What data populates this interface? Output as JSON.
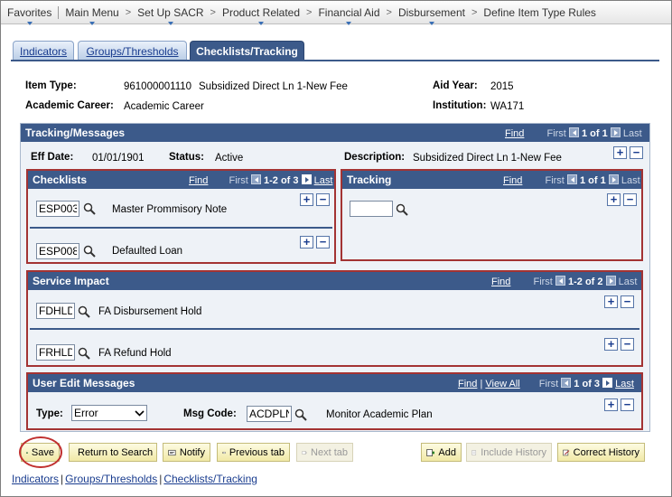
{
  "nav": {
    "items": [
      "Favorites",
      "Main Menu",
      "Set Up SACR",
      "Product Related",
      "Financial Aid",
      "Disbursement",
      "Define Item Type Rules"
    ]
  },
  "tabs": [
    "Indicators",
    "Groups/Thresholds",
    "Checklists/Tracking"
  ],
  "header": {
    "item_type_label": "Item Type:",
    "item_type_value": "961000001110",
    "item_type_desc": "Subsidized Direct Ln 1-New Fee",
    "academic_career_label": "Academic Career:",
    "academic_career_value": "Academic Career",
    "aid_year_label": "Aid Year:",
    "aid_year_value": "2015",
    "institution_label": "Institution:",
    "institution_value": "WA171"
  },
  "tracking_messages": {
    "title": "Tracking/Messages",
    "find": "Find",
    "first": "First",
    "count": "1 of 1",
    "last": "Last",
    "eff_date_label": "Eff Date:",
    "eff_date_value": "01/01/1901",
    "status_label": "Status:",
    "status_value": "Active",
    "description_label": "Description:",
    "description_value": "Subsidized Direct Ln 1-New Fee"
  },
  "checklists": {
    "title": "Checklists",
    "find": "Find",
    "first": "First",
    "count": "1-2 of 3",
    "last": "Last",
    "rows": [
      {
        "code": "ESP003",
        "desc": "Master Prommisory Note"
      },
      {
        "code": "ESP008",
        "desc": "Defaulted Loan"
      }
    ]
  },
  "tracking": {
    "title": "Tracking",
    "find": "Find",
    "first": "First",
    "count": "1 of 1",
    "last": "Last",
    "value": ""
  },
  "service_impact": {
    "title": "Service Impact",
    "find": "Find",
    "first": "First",
    "count": "1-2 of 2",
    "last": "Last",
    "rows": [
      {
        "code": "FDHLD",
        "desc": "FA Disbursement Hold"
      },
      {
        "code": "FRHLD",
        "desc": "FA Refund Hold"
      }
    ]
  },
  "user_edit": {
    "title": "User Edit Messages",
    "find": "Find",
    "view_all": "View All",
    "first": "First",
    "count": "1 of 3",
    "last": "Last",
    "type_label": "Type:",
    "type_value": "Error",
    "msg_code_label": "Msg Code:",
    "msg_code_value": "ACDPLN",
    "msg_desc": "Monitor Academic Plan"
  },
  "buttons": {
    "save": "Save",
    "return_search": "Return to Search",
    "notify": "Notify",
    "previous_tab": "Previous tab",
    "next_tab": "Next tab",
    "add": "Add",
    "include_history": "Include History",
    "correct_history": "Correct History"
  },
  "bottom_links": [
    "Indicators",
    "Groups/Thresholds",
    "Checklists/Tracking"
  ]
}
